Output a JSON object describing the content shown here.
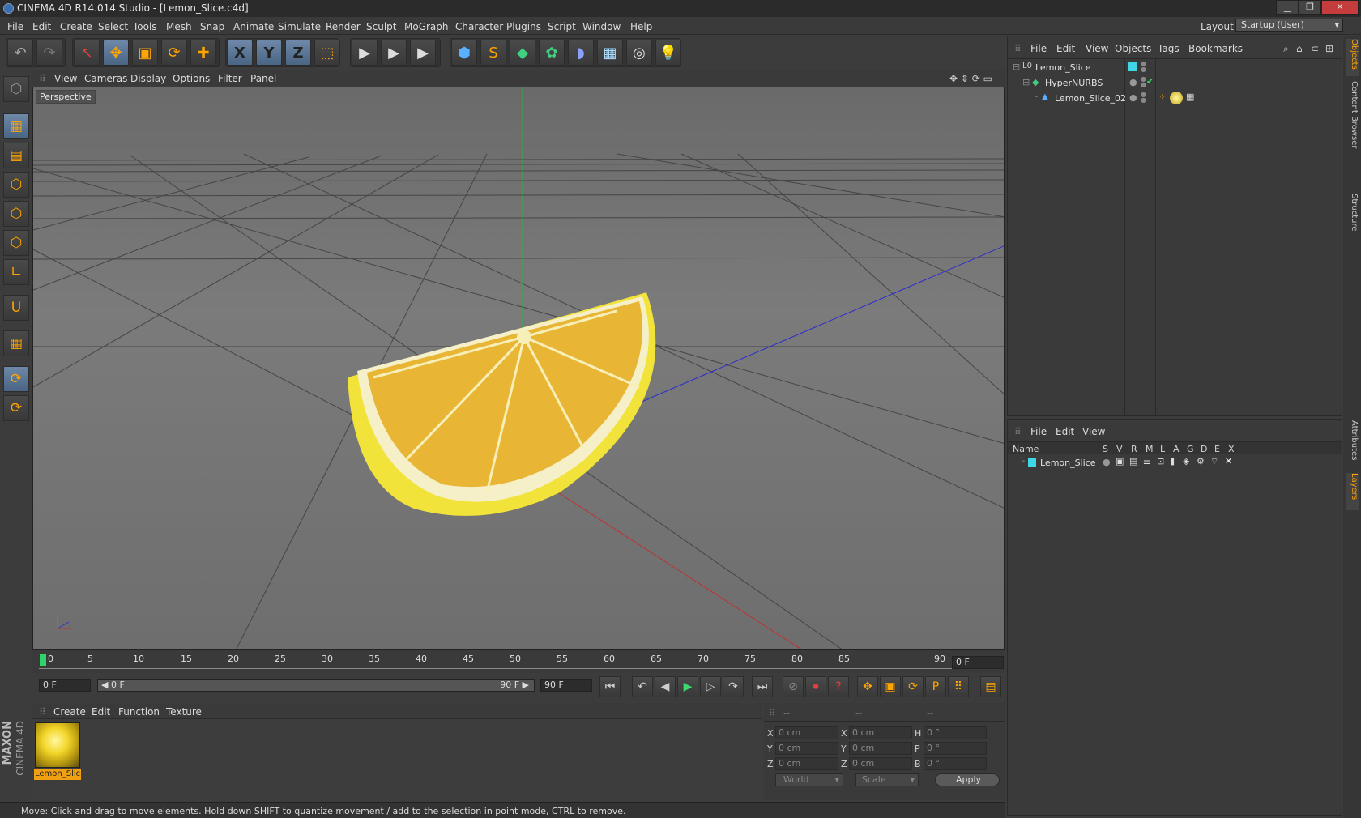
{
  "window": {
    "title": "CINEMA 4D R14.014 Studio - [Lemon_Slice.c4d]",
    "minimize": "▁",
    "restore": "❐",
    "close": "✕"
  },
  "menu": [
    "File",
    "Edit",
    "Create",
    "Select",
    "Tools",
    "Mesh",
    "Snap",
    "Animate",
    "Simulate",
    "Render",
    "Sculpt",
    "MoGraph",
    "Character",
    "Plugins",
    "Script",
    "Window",
    "Help"
  ],
  "layout": {
    "label": "Layout:",
    "value": "Startup (User)"
  },
  "toolbar": {
    "undo": "↶",
    "redo": "↷",
    "select": "↖",
    "move": "✥",
    "scale": "▣",
    "rotate": "⟳",
    "add": "✚",
    "x": "X",
    "y": "Y",
    "z": "Z",
    "coord": "⬚",
    "render_view": "▶",
    "render_picture": "▶",
    "render_settings": "▶",
    "cube": "⬢",
    "spline": "S",
    "nurbs": "◆",
    "array": "✿",
    "deformer": "◗",
    "scene": "▦",
    "camera": "◎",
    "light": "💡"
  },
  "left_tools": [
    "⬡",
    "▦",
    "▤",
    "⬡",
    "⬡",
    "⬡",
    "∟",
    "U",
    "▦",
    "⟳"
  ],
  "viewport": {
    "menu": [
      "View",
      "Cameras",
      "Display",
      "Options",
      "Filter",
      "Panel"
    ],
    "label": "Perspective",
    "nav": "✥ ⇕ ⟳ ▭"
  },
  "timeline": {
    "ticks": [
      "0",
      "5",
      "10",
      "15",
      "20",
      "25",
      "30",
      "35",
      "40",
      "45",
      "50",
      "55",
      "60",
      "65",
      "70",
      "75",
      "80",
      "85",
      "90"
    ],
    "current": "0 F"
  },
  "transport": {
    "start": "0 F",
    "range_start": "◀ 0 F",
    "range_end": "90 F ▶",
    "end": "90 F"
  },
  "materials": {
    "menu": [
      "Create",
      "Edit",
      "Function",
      "Texture"
    ],
    "items": [
      {
        "name": "Lemon_Slic"
      }
    ]
  },
  "coords": {
    "headers": [
      "--",
      "--",
      "--"
    ],
    "rows": [
      {
        "a": "X",
        "av": "0 cm",
        "b": "X",
        "bv": "0 cm",
        "c": "H",
        "cv": "0 °"
      },
      {
        "a": "Y",
        "av": "0 cm",
        "b": "Y",
        "bv": "0 cm",
        "c": "P",
        "cv": "0 °"
      },
      {
        "a": "Z",
        "av": "0 cm",
        "b": "Z",
        "bv": "0 cm",
        "c": "B",
        "cv": "0 °"
      }
    ],
    "mode1": "World",
    "mode2": "Scale",
    "apply": "Apply"
  },
  "status": "Move: Click and drag to move elements. Hold down SHIFT to quantize movement / add to the selection in point mode, CTRL to remove.",
  "brand": {
    "maxon": "MAXON",
    "cinema": "CINEMA 4D"
  },
  "objects": {
    "menu": [
      "File",
      "Edit",
      "View",
      "Objects",
      "Tags",
      "Bookmarks"
    ],
    "rows": [
      {
        "name": "Lemon_Slice",
        "icon": "L0"
      },
      {
        "name": "HyperNURBS",
        "icon": "◆"
      },
      {
        "name": "Lemon_Slice_02",
        "icon": "▲"
      }
    ]
  },
  "layers": {
    "menu": [
      "File",
      "Edit",
      "View"
    ],
    "headers": [
      "Name",
      "S",
      "V",
      "R",
      "M",
      "L",
      "A",
      "G",
      "D",
      "E",
      "X"
    ],
    "rows": [
      {
        "name": "Lemon_Slice"
      }
    ]
  },
  "right_tabs": [
    "Objects",
    "Content Browser",
    "Structure",
    "Attributes",
    "Layers"
  ],
  "colors": {
    "accent": "#ffa400",
    "layer_color": "#3fd6e6",
    "grid": "#3a3a3a"
  }
}
